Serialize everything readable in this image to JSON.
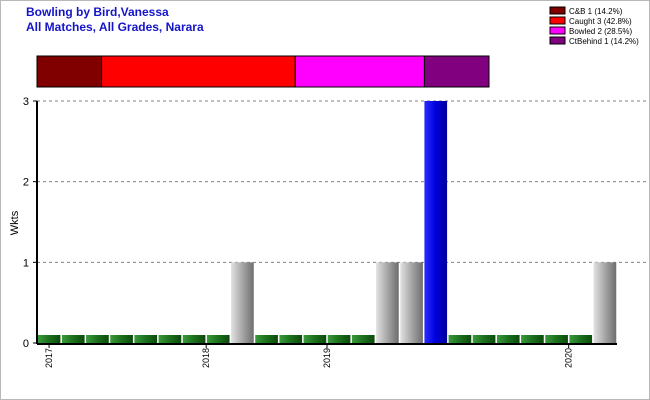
{
  "header": {
    "title_line1": "Bowling by Bird,Vanessa",
    "title_line2": "All Matches, All Grades, Narara"
  },
  "chart_data": {
    "type": "bar",
    "ylabel": "Wkts",
    "ylim": [
      0,
      3
    ],
    "y_ticks": [
      "0",
      "1",
      "2",
      "3"
    ],
    "x_tick_labels": [
      "2017",
      "2018",
      "2019",
      "2020"
    ],
    "x_tick_positions": [
      0,
      6.5,
      11.5,
      21.5
    ],
    "grid": "horizontal-dashed",
    "legend_position": "top-right",
    "values": [
      0,
      0,
      0,
      0,
      0,
      0,
      0,
      0,
      1,
      0,
      0,
      0,
      0,
      0,
      1,
      1,
      3,
      0,
      0,
      0,
      0,
      0,
      0,
      1
    ],
    "bar_kinds": [
      "zero",
      "zero",
      "zero",
      "zero",
      "zero",
      "zero",
      "zero",
      "zero",
      "grey",
      "zero",
      "zero",
      "zero",
      "zero",
      "zero",
      "grey",
      "grey",
      "blue",
      "zero",
      "zero",
      "zero",
      "zero",
      "zero",
      "zero",
      "grey"
    ],
    "dismissals": [
      {
        "label": "C&B 1 (14.2%)",
        "value": 1,
        "color": "#800000"
      },
      {
        "label": "Caught 3 (42.8%)",
        "value": 3,
        "color": "#ff0000"
      },
      {
        "label": "Bowled 2 (28.5%)",
        "value": 2,
        "color": "#ff00ff"
      },
      {
        "label": "CtBehind 1 (14.2%)",
        "value": 1,
        "color": "#800080"
      }
    ],
    "colors": {
      "zero_bar": "#1f7a1f",
      "grey_bar": "#a8a8a8",
      "blue_bar": "#0000e0",
      "axis": "#000000",
      "grid": "#808080"
    }
  }
}
